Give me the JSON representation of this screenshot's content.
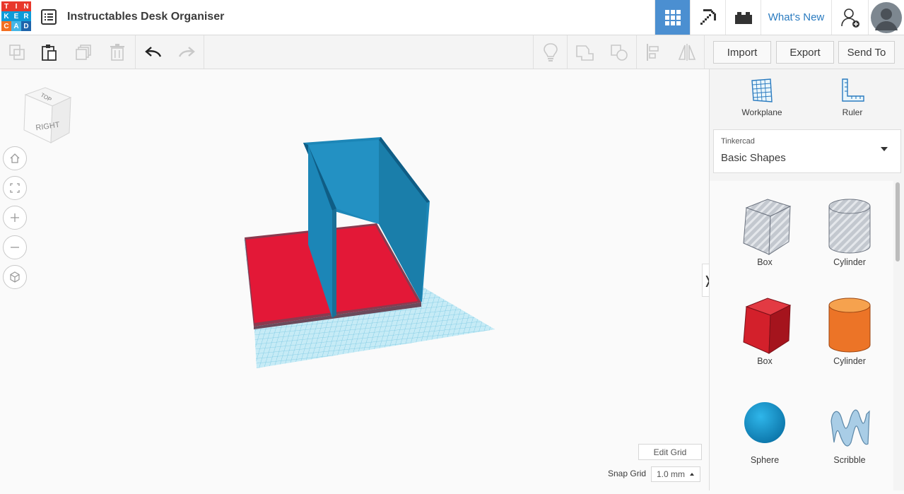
{
  "app": {
    "logo_letters": [
      "T",
      "I",
      "N",
      "K",
      "E",
      "R",
      "C",
      "A",
      "D"
    ],
    "logo_colors": [
      "#e8382c",
      "#e8382c",
      "#e8382c",
      "#0e9bd8",
      "#0e9bd8",
      "#0e9bd8",
      "#f36f21",
      "#45b6e6",
      "#1e64ab"
    ],
    "design_title": "Instructables Desk Organiser"
  },
  "topbar": {
    "whats_new": "What's New",
    "accent": "#4b8fd1"
  },
  "toolbar": {
    "import_label": "Import",
    "export_label": "Export",
    "send_to_label": "Send To"
  },
  "panel": {
    "workplane_label": "Workplane",
    "ruler_label": "Ruler",
    "library_source": "Tinkercad",
    "library_name": "Basic Shapes",
    "shapes": [
      {
        "label": "Box",
        "icon": "box-hole-icon"
      },
      {
        "label": "Cylinder",
        "icon": "cylinder-hole-icon"
      },
      {
        "label": "Box",
        "icon": "box-red-icon"
      },
      {
        "label": "Cylinder",
        "icon": "cylinder-orange-icon"
      },
      {
        "label": "Sphere",
        "icon": "sphere-blue-icon"
      },
      {
        "label": "Scribble",
        "icon": "scribble-icon"
      }
    ]
  },
  "viewcube": {
    "front_face": "RIGHT",
    "top_face": "TOP"
  },
  "grid": {
    "edit_grid_label": "Edit Grid",
    "snap_grid_label": "Snap Grid",
    "snap_value": "1.0 mm"
  },
  "colors": {
    "red_part": "#e31837",
    "blue_part": "#1c86b7",
    "grid": "#8ed2e9"
  }
}
